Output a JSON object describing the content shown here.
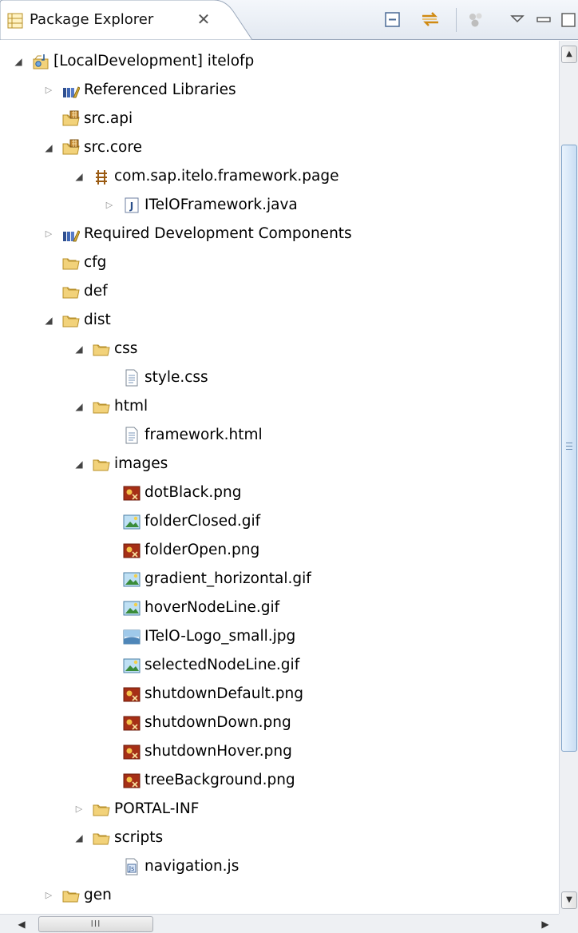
{
  "view": {
    "title": "Package Explorer",
    "close_glyph": "✕"
  },
  "tree": {
    "rows": [
      {
        "label": "[LocalDevelopment] itelofp",
        "icon": "project-icon",
        "state": "expanded"
      },
      {
        "label": "Referenced Libraries",
        "icon": "libraries-icon",
        "state": "collapsed"
      },
      {
        "label": "src.api",
        "icon": "source-folder-icon",
        "state": "none"
      },
      {
        "label": "src.core",
        "icon": "source-folder-icon",
        "state": "expanded"
      },
      {
        "label": "com.sap.itelo.framework.page",
        "icon": "package-icon",
        "state": "expanded"
      },
      {
        "label": "ITelOFramework.java",
        "icon": "java-file-icon",
        "state": "collapsed"
      },
      {
        "label": "Required Development Components",
        "icon": "libraries-icon",
        "state": "collapsed"
      },
      {
        "label": "cfg",
        "icon": "folder-icon",
        "state": "none"
      },
      {
        "label": "def",
        "icon": "folder-icon",
        "state": "none"
      },
      {
        "label": "dist",
        "icon": "folder-icon",
        "state": "expanded"
      },
      {
        "label": "css",
        "icon": "folder-icon",
        "state": "expanded"
      },
      {
        "label": "style.css",
        "icon": "text-file-icon",
        "state": "none"
      },
      {
        "label": "html",
        "icon": "folder-icon",
        "state": "expanded"
      },
      {
        "label": "framework.html",
        "icon": "text-file-icon",
        "state": "none"
      },
      {
        "label": "images",
        "icon": "folder-icon",
        "state": "expanded"
      },
      {
        "label": "dotBlack.png",
        "icon": "png-file-icon",
        "state": "none"
      },
      {
        "label": "folderClosed.gif",
        "icon": "gif-file-icon",
        "state": "none"
      },
      {
        "label": "folderOpen.png",
        "icon": "png-file-icon",
        "state": "none"
      },
      {
        "label": "gradient_horizontal.gif",
        "icon": "gif-file-icon",
        "state": "none"
      },
      {
        "label": "hoverNodeLine.gif",
        "icon": "gif-file-icon",
        "state": "none"
      },
      {
        "label": "ITelO-Logo_small.jpg",
        "icon": "jpg-file-icon",
        "state": "none"
      },
      {
        "label": "selectedNodeLine.gif",
        "icon": "gif-file-icon",
        "state": "none"
      },
      {
        "label": "shutdownDefault.png",
        "icon": "png-file-icon",
        "state": "none"
      },
      {
        "label": "shutdownDown.png",
        "icon": "png-file-icon",
        "state": "none"
      },
      {
        "label": "shutdownHover.png",
        "icon": "png-file-icon",
        "state": "none"
      },
      {
        "label": "treeBackground.png",
        "icon": "png-file-icon",
        "state": "none"
      },
      {
        "label": "PORTAL-INF",
        "icon": "folder-icon",
        "state": "collapsed"
      },
      {
        "label": "scripts",
        "icon": "folder-icon",
        "state": "expanded"
      },
      {
        "label": "navigation.js",
        "icon": "js-file-icon",
        "state": "none"
      },
      {
        "label": "gen",
        "icon": "folder-icon",
        "state": "collapsed"
      }
    ]
  },
  "scrollbars": {
    "horizontal_thumb_grip": "III"
  },
  "colors": {
    "folder": "#f2d27a",
    "folder_border": "#b8902a",
    "tab_border": "#9aa8bb",
    "scroll_thumb": "#c9def3"
  }
}
